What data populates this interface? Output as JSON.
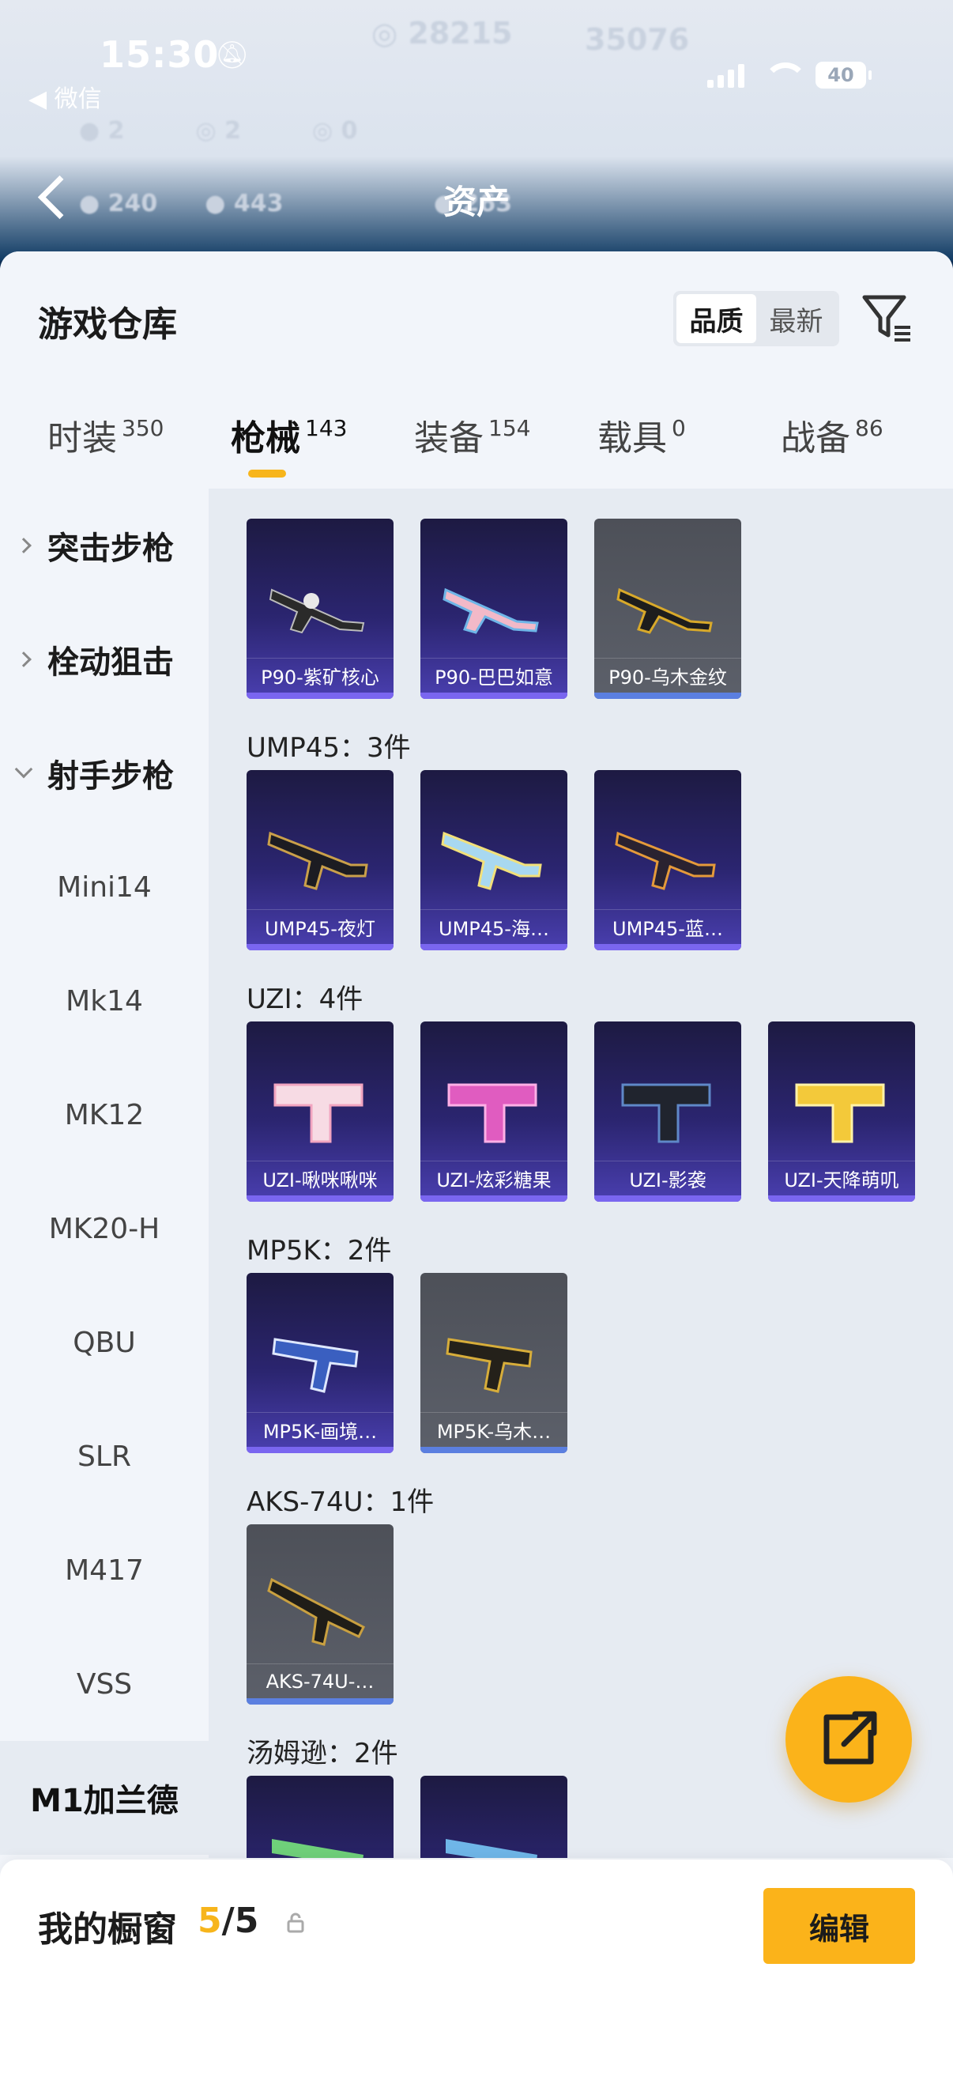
{
  "status_bar": {
    "time": "15:30",
    "back_app": "◀ 微信",
    "battery": "40"
  },
  "nav": {
    "title": "资产"
  },
  "header": {
    "title": "游戏仓库",
    "sort_options": [
      "品质",
      "最新"
    ],
    "active_sort": "品质"
  },
  "tabs": [
    {
      "label": "时装",
      "count": "350"
    },
    {
      "label": "枪械",
      "count": "143",
      "active": true
    },
    {
      "label": "装备",
      "count": "154"
    },
    {
      "label": "载具",
      "count": "0"
    },
    {
      "label": "战备",
      "count": "86"
    }
  ],
  "categories": [
    {
      "label": "突击步枪",
      "expanded": false
    },
    {
      "label": "栓动狙击",
      "expanded": false
    },
    {
      "label": "射手步枪",
      "expanded": true
    }
  ],
  "subcategories": [
    "Mini14",
    "Mk14",
    "MK12",
    "MK20-H",
    "QBU",
    "SLR",
    "M417",
    "VSS",
    "M1加兰德"
  ],
  "selected_subcategory": "M1加兰德",
  "groups": [
    {
      "heading": "UMP45：3件"
    },
    {
      "heading": "UZI：4件"
    },
    {
      "heading": "MP5K：2件"
    },
    {
      "heading": "AKS-74U：1件"
    },
    {
      "heading": "汤姆逊：2件"
    }
  ],
  "items": {
    "p90": [
      "P90-紫矿核心",
      "P90-巴巴如意",
      "P90-乌木金纹"
    ],
    "ump45": [
      "UMP45-夜灯",
      "UMP45-海…",
      "UMP45-蓝…"
    ],
    "uzi": [
      "UZI-啾咪啾咪",
      "UZI-炫彩糖果",
      "UZI-影袭",
      "UZI-天降萌叽"
    ],
    "mp5k": [
      "MP5K-画境…",
      "MP5K-乌木…"
    ],
    "aks": [
      "AKS-74U-…"
    ]
  },
  "showcase": {
    "label": "我的橱窗",
    "current": "5",
    "total": "/5",
    "edit_label": "编辑"
  },
  "colors": {
    "accent": "#fbb31a",
    "card_purple": "#2b2570",
    "card_gray": "#5c606a"
  }
}
